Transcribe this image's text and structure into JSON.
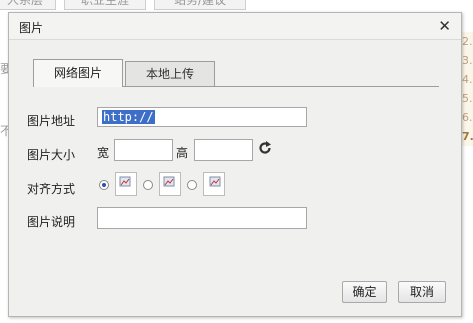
{
  "background": {
    "tabs": [
      "人系层",
      "职业生涯",
      "站务/建议"
    ],
    "left_fragments": [
      "要",
      "不"
    ],
    "right_numbers": [
      "2.",
      "3.",
      "4.",
      "5.",
      "6.",
      "7."
    ]
  },
  "dialog": {
    "title": "图片",
    "tabs": [
      {
        "label": "网络图片",
        "active": true
      },
      {
        "label": "本地上传",
        "active": false
      }
    ],
    "fields": {
      "url_label": "图片地址",
      "url_value": "http://",
      "size_label": "图片大小",
      "width_label": "宽",
      "height_label": "高",
      "width_value": "",
      "height_value": "",
      "align_label": "对齐方式",
      "align_selected": 0,
      "desc_label": "图片说明",
      "desc_value": ""
    },
    "buttons": {
      "ok": "确定",
      "cancel": "取消"
    }
  },
  "icons": {
    "close": "close-icon",
    "refresh": "refresh-icon",
    "align": [
      "align-none-icon",
      "align-left-icon",
      "align-right-icon"
    ]
  }
}
